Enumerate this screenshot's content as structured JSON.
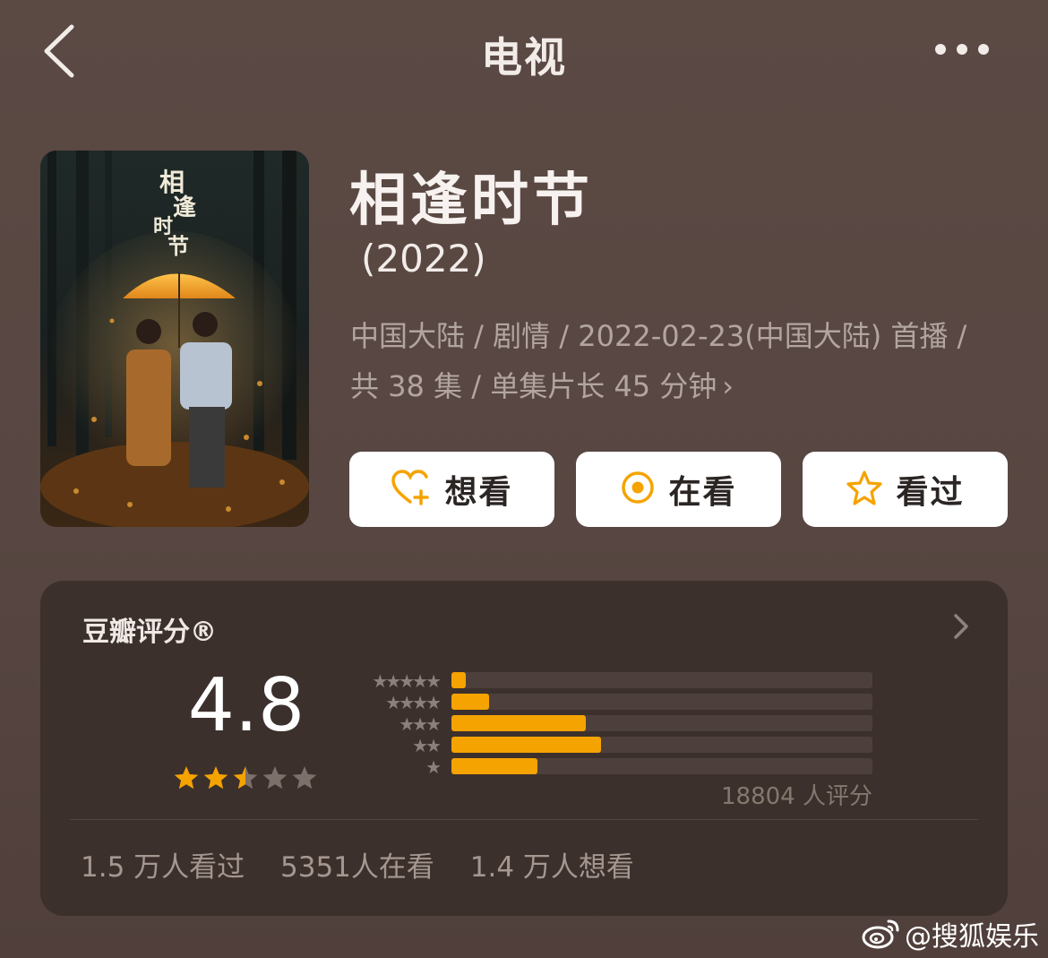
{
  "nav": {
    "title": "电视"
  },
  "show": {
    "title": "相逢时节",
    "year": "(2022)",
    "meta_line1": "中国大陆 / 剧情 / 2022-02-23(中国大陆) 首播 /",
    "meta_line2": "共 38 集 / 单集片长 45 分钟",
    "meta_chevron": "›",
    "poster_title_vertical": "相逢时节"
  },
  "actions": [
    {
      "label": "想看",
      "icon": "heart-plus-icon"
    },
    {
      "label": "在看",
      "icon": "target-circle-icon"
    },
    {
      "label": "看过",
      "icon": "star-outline-icon"
    }
  ],
  "rating": {
    "title": "豆瓣评分®",
    "score": "4.8",
    "stars_value": 2.5,
    "stars_max": 5,
    "distribution": [
      {
        "stars": 5,
        "percent": 3.5
      },
      {
        "stars": 4,
        "percent": 9
      },
      {
        "stars": 3,
        "percent": 32
      },
      {
        "stars": 2,
        "percent": 35.5
      },
      {
        "stars": 1,
        "percent": 20.5
      }
    ],
    "count_text": "18804 人评分",
    "summary": [
      "1.5 万人看过",
      "5351人在看",
      "1.4 万人想看"
    ]
  },
  "colors": {
    "accent": "#f5a300",
    "star_empty": "#7c706b",
    "card_bg": "#3c302c"
  },
  "watermark": {
    "text": "@搜狐娱乐",
    "icon": "weibo-icon"
  }
}
